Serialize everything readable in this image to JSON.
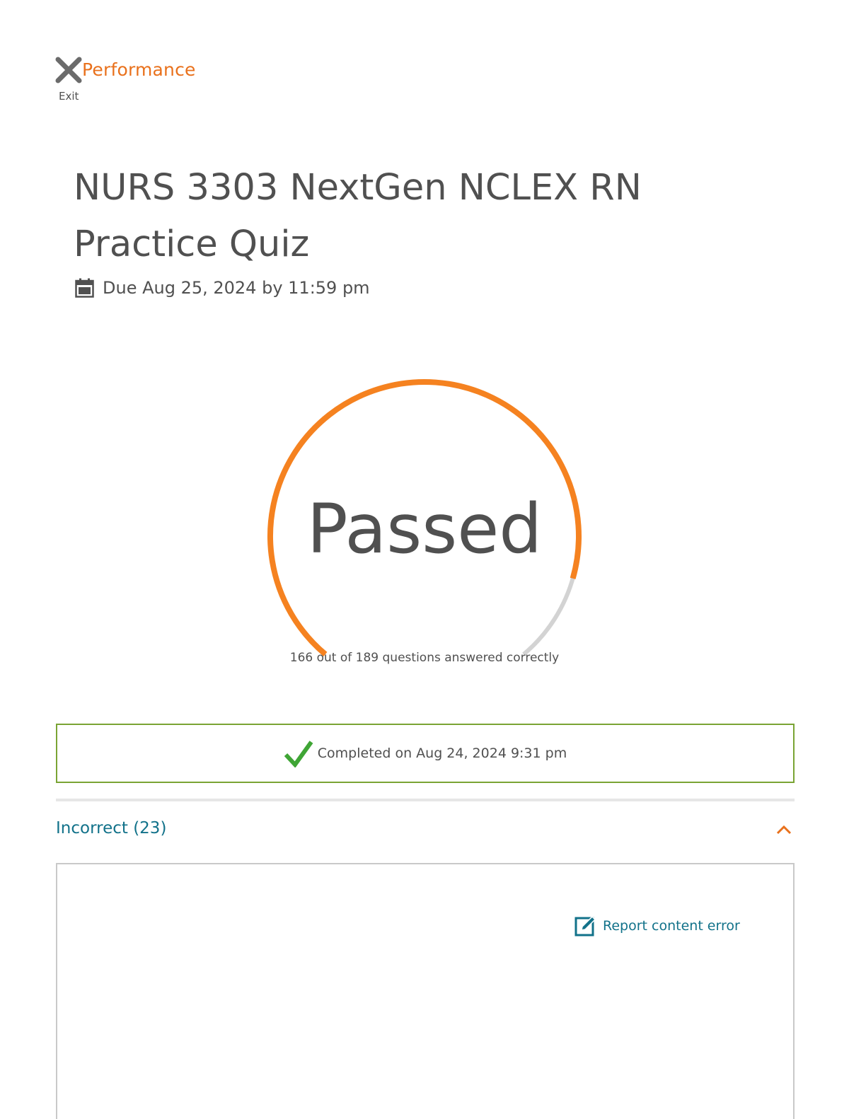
{
  "header": {
    "title": "Performance",
    "exit_label": "Exit",
    "exit_icon": "close-x-icon"
  },
  "quiz": {
    "title": "NURS 3303 NextGen NCLEX RN Practice Quiz",
    "due": "Due Aug 25, 2024 by 11:59 pm",
    "due_icon": "calendar-icon"
  },
  "result": {
    "status": "Passed",
    "correct": 166,
    "total": 189,
    "caption": "166 out of 189 questions answered correctly"
  },
  "completion": {
    "text": "Completed on Aug 24, 2024 9:31 pm",
    "icon": "checkmark-icon"
  },
  "incorrect_section": {
    "label": "Incorrect (23)",
    "expanded": true,
    "toggle_icon": "chevron-up-icon"
  },
  "question": {
    "report_label": "Report content error",
    "report_icon": "edit-icon"
  },
  "colors": {
    "accent": "#e9711c",
    "ring_progress": "#f58220",
    "ring_track": "#d3d3d3",
    "link": "#12728a",
    "success": "#3fa535",
    "banner_border": "#7aa434"
  }
}
